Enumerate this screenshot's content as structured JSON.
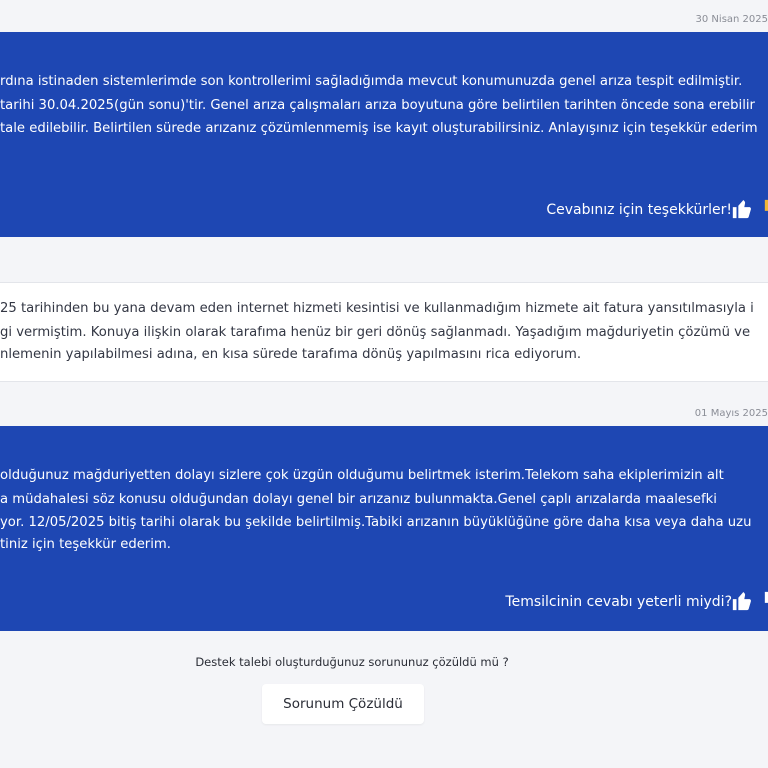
{
  "conversation": {
    "date_1": "30 Nisan 2025",
    "rep_message_1": {
      "line_1": "rdına istinaden sistemlerimde son kontrollerimi sağladığımda mevcut konumunuzda genel arıza tespit edilmiştir.",
      "line_2": "tarihi 30.04.2025(gün sonu)'tir. Genel arıza çalışmaları arıza boyutuna göre belirtilen tarihten öncede sona erebilir",
      "line_3": "tale edilebilir. Belirtilen sürede arızanız çözümlenmemiş ise kayıt oluşturabilirsiniz. Anlayışınız için teşekkür ederim",
      "feedback_label": "Cevabınız için teşekkürler!"
    },
    "user_message": {
      "line_1": "25 tarihinden bu yana devam eden internet hizmeti kesintisi ve kullanmadığım hizmete ait fatura yansıtılmasıyla i",
      "line_2": "gi vermiştim. Konuya ilişkin olarak tarafıma henüz bir geri dönüş sağlanmadı. Yaşadığım mağduriyetin çözümü ve",
      "line_3": "nlemenin yapılabilmesi adına, en kısa sürede tarafıma dönüş yapılmasını rica ediyorum."
    },
    "date_2": "01 Mayıs 2025",
    "rep_message_2": {
      "line_1": "olduğunuz mağduriyetten dolayı sizlere çok üzgün olduğumu belirtmek isterim.Telekom saha ekiplerimizin alt",
      "line_2": "a müdahalesi söz konusu olduğundan dolayı genel bir arızanız bulunmakta.Genel çaplı arızalarda maalesefki",
      "line_3": "yor. 12/05/2025 bitiş tarihi olarak bu şekilde belirtilmiş.Tabiki arızanın büyüklüğüne göre daha kısa veya daha uzu",
      "line_4": "tiniz için teşekkür ederim.",
      "feedback_label": "Temsilcinin cevabı yeterli miydi?"
    }
  },
  "resolution": {
    "question": "Destek talebi oluşturduğunuz sorununuz çözüldü mü ?",
    "button_label": "Sorunum Çözüldü"
  },
  "icons": {
    "thumb_up": "thumbs-up-icon",
    "thumb_down": "thumbs-down-icon"
  },
  "colors": {
    "rep_bubble": "#1e47b3",
    "user_bubble": "#ffffff",
    "page_background": "#f4f5f8"
  }
}
